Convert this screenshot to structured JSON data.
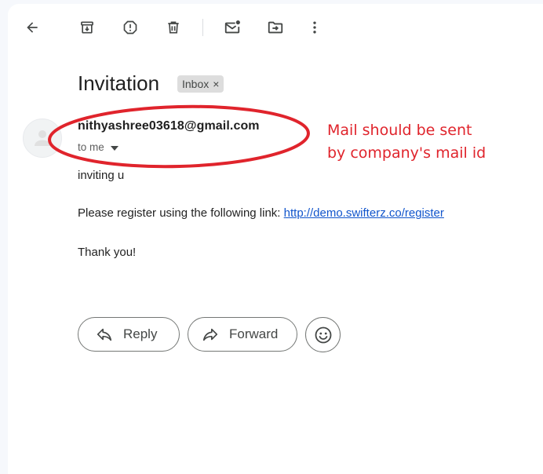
{
  "toolbar": {
    "icons": [
      "back-arrow-icon",
      "archive-icon",
      "report-spam-icon",
      "delete-icon",
      "mark-unread-icon",
      "move-to-icon",
      "more-vert-icon"
    ]
  },
  "email": {
    "subject": "Invitation",
    "label": "Inbox",
    "label_close": "×",
    "sender": "nithyashree03618@gmail.com",
    "recipient_line": "to me",
    "body_line1": "inviting u",
    "body_line2_prefix": "Please register using the following link: ",
    "link_text": "http://demo.swifterz.co/register",
    "closing": "Thank you!"
  },
  "annotation": {
    "line1": "Mail should be sent",
    "line2": "by company's mail id",
    "color": "#e0242c"
  },
  "actions": {
    "reply_label": "Reply",
    "forward_label": "Forward",
    "emoji_icon": "emoji-smile-icon"
  },
  "colors": {
    "background": "#f6f8fc",
    "panel": "#ffffff",
    "link": "#1155cc",
    "icon": "#444746"
  }
}
